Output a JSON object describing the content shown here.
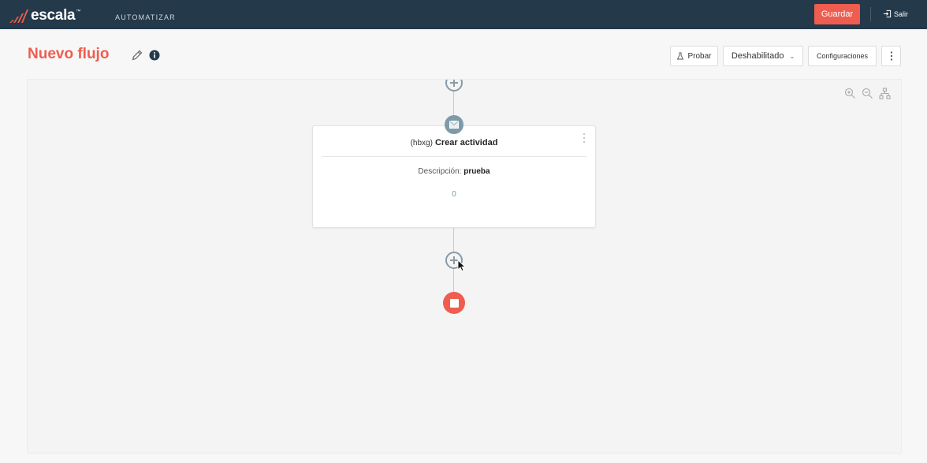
{
  "topbar": {
    "brand_name": "escala",
    "brand_tm": "™",
    "module_name": "AUTOMATIZAR",
    "save_label": "Guardar",
    "exit_label": "Salir"
  },
  "header": {
    "title": "Nuevo flujo",
    "test_label": "Probar",
    "status_value": "Deshabilitado",
    "config_label": "Configuraciones"
  },
  "flow": {
    "activity_card": {
      "code": "(hbxg)",
      "name": "Crear actividad",
      "description_label": "Descripción:",
      "description_value": "prueba",
      "count": "0"
    }
  },
  "icons": {
    "edit": "pencil-icon",
    "info": "info-icon",
    "test": "flask-icon",
    "zoom_in": "zoom-in-icon",
    "zoom_out": "zoom-out-icon",
    "layout": "hierarchy-icon",
    "activity": "envelope-icon",
    "end": "stop-icon",
    "exit": "sign-out-icon"
  },
  "colors": {
    "topbar": "#24394a",
    "accent": "#ee5d4f",
    "node": "#7d9aa9",
    "canvas": "#f4f4f4"
  }
}
